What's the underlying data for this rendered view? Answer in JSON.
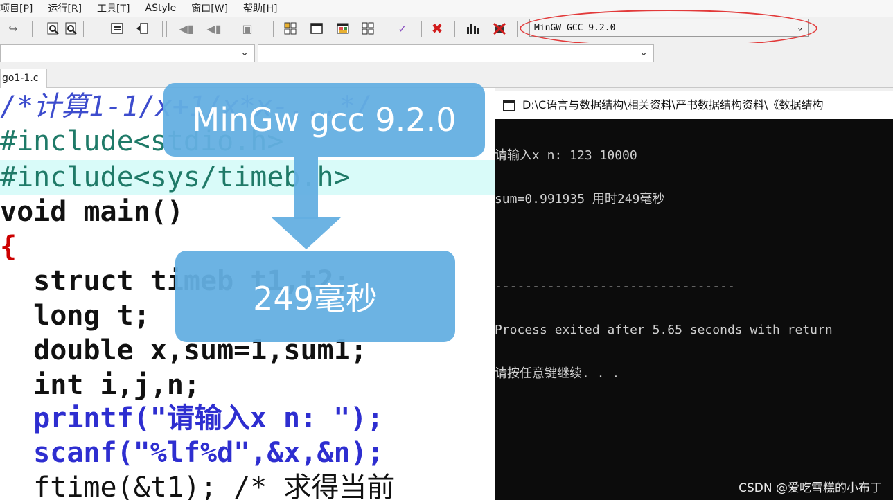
{
  "menu": [
    "项目[P]",
    "运行[R]",
    "工具[T]",
    "AStyle",
    "窗口[W]",
    "帮助[H]"
  ],
  "toolbar": {
    "compiler": "MinGW GCC 9.2.0",
    "icons": [
      "redo-icon",
      "find-icon",
      "find-next-icon",
      "insert-icon",
      "indent-icon",
      "bookmark-prev-icon",
      "bookmark-next-icon",
      "toggle-icon",
      "grid-icon",
      "window-icon",
      "layout-icon",
      "tile-icon",
      "check-icon",
      "close-icon",
      "chart-icon",
      "debug-icon"
    ]
  },
  "tab": {
    "label": "go1-1.c"
  },
  "editor": {
    "lines": [
      "/*计算1-1/x+1/x*x-...*/",
      "#include<stdio.h>",
      "#include<sys/timeb.h>",
      "void main()",
      "{",
      "  struct timeb t1,t2;",
      "  long t;",
      "  double x,sum=1,sum1;",
      "  int i,j,n;",
      "  printf(\"请输入x n: \");",
      "  scanf(\"%lf%d\",&x,&n);",
      "  ftime(&t1); /* 求得当前"
    ]
  },
  "console": {
    "title": "D:\\C语言与数据结构\\相关资料\\严书数据结构资料\\《数据结构",
    "lines": [
      "请输入x n: 123 10000",
      "sum=0.991935 用时249毫秒",
      "",
      "--------------------------------",
      "Process exited after 5.65 seconds with return",
      "请按任意键继续. . ."
    ]
  },
  "callouts": {
    "compiler": "MinGw gcc 9.2.0",
    "time": "249毫秒"
  },
  "watermark": "CSDN @爱吃雪糕的小布丁",
  "colors": {
    "annotation_circle": "#e23a3a",
    "callout": "#64afe1",
    "line_highlight": "#d9fbf9"
  }
}
